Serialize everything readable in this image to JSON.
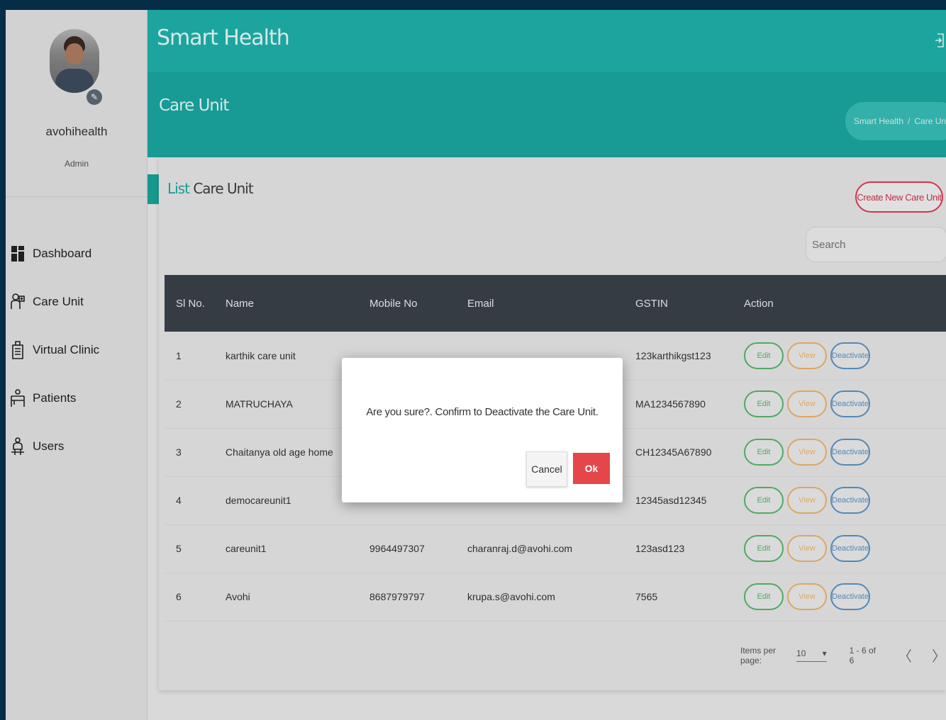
{
  "app": {
    "title": "Smart Health",
    "logout_icon": "logout-icon"
  },
  "profile": {
    "name": "avohihealth",
    "role": "Admin"
  },
  "sidebar": {
    "items": [
      {
        "label": "Dashboard",
        "icon": "dashboard-icon"
      },
      {
        "label": "Care Unit",
        "icon": "care-unit-icon"
      },
      {
        "label": "Virtual Clinic",
        "icon": "virtual-clinic-icon"
      },
      {
        "label": "Patients",
        "icon": "patients-icon"
      },
      {
        "label": "Users",
        "icon": "users-icon"
      }
    ]
  },
  "page": {
    "title": "Care Unit",
    "breadcrumb": [
      "Smart Health",
      "Care Unit"
    ],
    "breadcrumb_sep": "/"
  },
  "card": {
    "title_first": "List",
    "title_rest": "Care Unit",
    "create_label": "Create New Care Unit",
    "search_placeholder": "Search"
  },
  "table": {
    "headers": [
      "Sl No.",
      "Name",
      "Mobile No",
      "Email",
      "GSTIN",
      "Action"
    ],
    "action_labels": {
      "edit": "Edit",
      "view": "View",
      "deactivate": "Deactivate"
    },
    "rows": [
      {
        "sl": "1",
        "name": "karthik care unit",
        "mobile": "",
        "email": "",
        "gstin": "123karthikgst123"
      },
      {
        "sl": "2",
        "name": "MATRUCHAYA",
        "mobile": "",
        "email": "",
        "gstin": "MA1234567890"
      },
      {
        "sl": "3",
        "name": "Chaitanya old age home",
        "mobile": "",
        "email": "",
        "gstin": "CH12345A67890"
      },
      {
        "sl": "4",
        "name": "democareunit1",
        "mobile": "",
        "email": "",
        "gstin": "12345asd12345"
      },
      {
        "sl": "5",
        "name": "careunit1",
        "mobile": "9964497307",
        "email": "charanraj.d@avohi.com",
        "gstin": "123asd123"
      },
      {
        "sl": "6",
        "name": "Avohi",
        "mobile": "8687979797",
        "email": "krupa.s@avohi.com",
        "gstin": "7565"
      }
    ]
  },
  "pagination": {
    "items_per_page_label": "Items per page:",
    "items_per_page_value": "10",
    "range": "1 - 6 of 6",
    "prev": "〈",
    "next": "〉"
  },
  "modal": {
    "message": "Are you sure?. Confirm to Deactivate the Care Unit.",
    "cancel": "Cancel",
    "ok": "Ok"
  },
  "colors": {
    "header": "#1fb3ac",
    "subheader": "#1ba9a1",
    "create_button": "#e03a56",
    "ok_button": "#e5464a",
    "table_header": "#3a4249"
  }
}
